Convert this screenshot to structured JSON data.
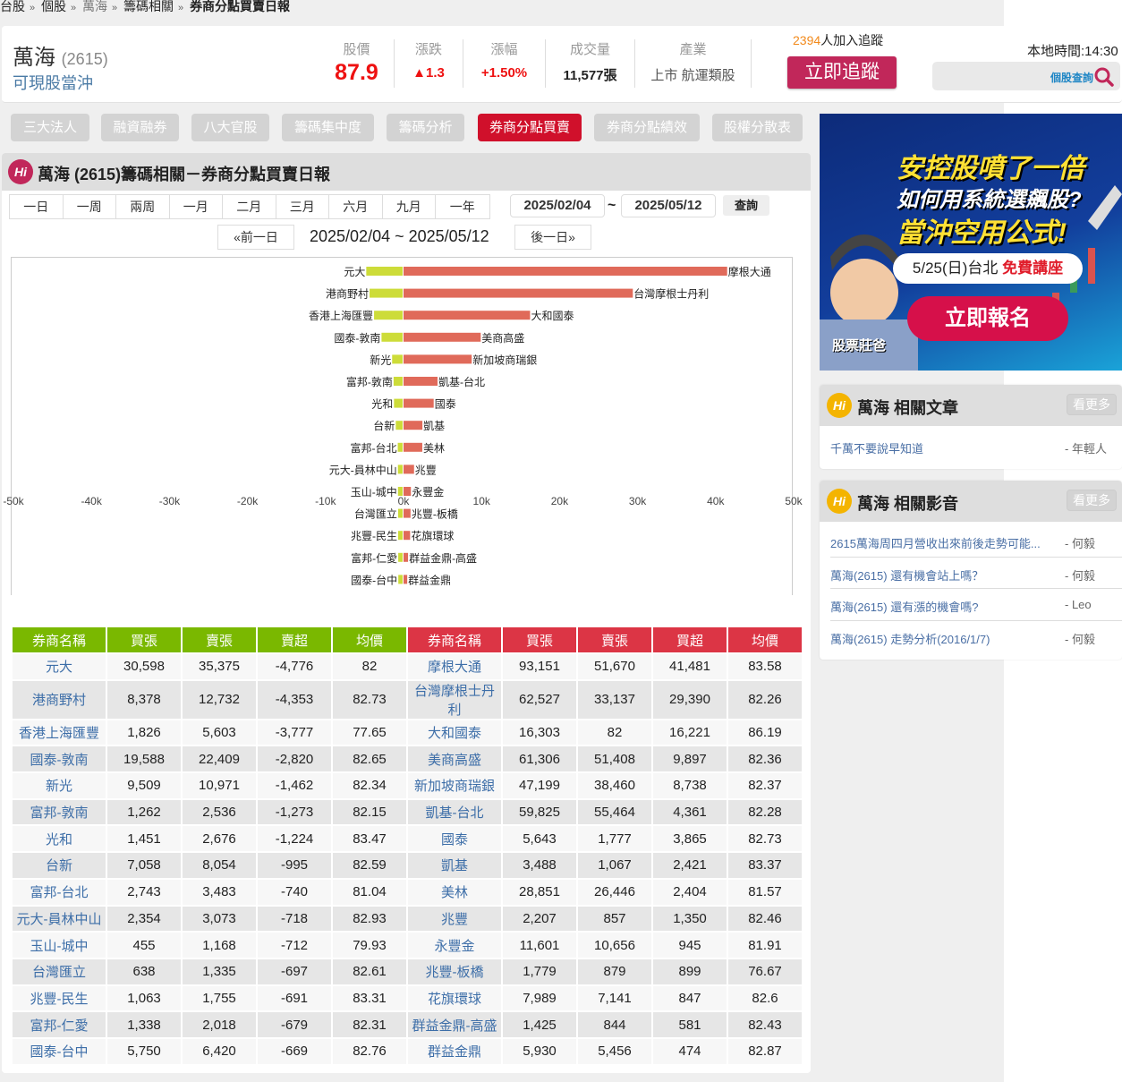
{
  "breadcrumb": [
    "台股",
    "個股",
    "萬海",
    "籌碼相關",
    "券商分點買賣日報"
  ],
  "stock": {
    "name": "萬海",
    "code": "(2615)",
    "tag": "可現股當沖"
  },
  "stats": [
    {
      "label": "股價",
      "value": "87.9",
      "color": "#ee1111"
    },
    {
      "label": "漲跌",
      "value": "▲1.3",
      "color": "#ee1111"
    },
    {
      "label": "漲幅",
      "value": "+1.50%",
      "color": "#ee1111"
    },
    {
      "label": "成交量",
      "value": "11,577張",
      "color": "#222222"
    },
    {
      "label": "產業",
      "value": "上市 航運類股",
      "color": "#555555"
    }
  ],
  "follow": {
    "count": "2394",
    "count_suffix": "人加入追蹤",
    "button": "立即追蹤"
  },
  "local_time": "本地時間:14:30",
  "search": {
    "label": "個股查詢"
  },
  "tabs": [
    {
      "label": "三大法人",
      "active": false
    },
    {
      "label": "融資融券",
      "active": false
    },
    {
      "label": "八大官股",
      "active": false
    },
    {
      "label": "籌碼集中度",
      "active": false
    },
    {
      "label": "籌碼分析",
      "active": false
    },
    {
      "label": "券商分點買賣",
      "active": true
    },
    {
      "label": "券商分點績效",
      "active": false
    },
    {
      "label": "股權分散表",
      "active": false
    }
  ],
  "panel": {
    "title": "萬海 (2615)籌碼相關－券商分點買賣日報",
    "periods": [
      "一日",
      "一周",
      "兩周",
      "一月",
      "二月",
      "三月",
      "六月",
      "九月",
      "一年"
    ],
    "start_date": "2025/02/04",
    "tilde": "~",
    "end_date": "2025/05/12",
    "query": "查詢",
    "prev": "«前一日",
    "next": "後一日»",
    "range": "2025/02/04 ~ 2025/05/12"
  },
  "colors": {
    "sell_bar": "#cddc39",
    "buy_bar": "#e06a5a",
    "sell_header": "#7ab800",
    "buy_header": "#dc3545",
    "accent": "#c1275a"
  },
  "chart_data": {
    "type": "bar",
    "orientation": "horizontal",
    "grid": false,
    "xlim": [
      -50000,
      50000
    ],
    "xticks": [
      "-50k",
      "-40k",
      "-30k",
      "-20k",
      "-10k",
      "0k",
      "10k",
      "20k",
      "30k",
      "40k",
      "50k"
    ],
    "sell_labels": [
      "元大",
      "港商野村",
      "香港上海匯豐",
      "國泰-敦南",
      "新光",
      "富邦-敦南",
      "光和",
      "台新",
      "富邦-台北",
      "元大-員林中山",
      "玉山-城中",
      "台灣匯立",
      "兆豐-民生",
      "富邦-仁愛",
      "國泰-台中"
    ],
    "sell_values": [
      -4776,
      -4353,
      -3777,
      -2820,
      -1462,
      -1273,
      -1224,
      -995,
      -740,
      -718,
      -712,
      -697,
      -691,
      -679,
      -669
    ],
    "buy_labels": [
      "摩根大通",
      "台灣摩根士丹利",
      "大和國泰",
      "美商高盛",
      "新加坡商瑞銀",
      "凱基-台北",
      "國泰",
      "凱基",
      "美林",
      "兆豐",
      "永豐金",
      "兆豐-板橋",
      "花旗環球",
      "群益金鼎-高盛",
      "群益金鼎"
    ],
    "buy_values": [
      41481,
      29390,
      16221,
      9897,
      8738,
      4361,
      3865,
      2421,
      2404,
      1350,
      945,
      899,
      847,
      581,
      474
    ]
  },
  "table": {
    "sell_headers": [
      "券商名稱",
      "買張",
      "賣張",
      "賣超",
      "均價"
    ],
    "buy_headers": [
      "券商名稱",
      "買張",
      "賣張",
      "買超",
      "均價"
    ],
    "rows": [
      [
        [
          "元大",
          "30,598",
          "35,375",
          "-4,776",
          "82"
        ],
        [
          "摩根大通",
          "93,151",
          "51,670",
          "41,481",
          "83.58"
        ]
      ],
      [
        [
          "港商野村",
          "8,378",
          "12,732",
          "-4,353",
          "82.73"
        ],
        [
          "台灣摩根士丹利",
          "62,527",
          "33,137",
          "29,390",
          "82.26"
        ]
      ],
      [
        [
          "香港上海匯豐",
          "1,826",
          "5,603",
          "-3,777",
          "77.65"
        ],
        [
          "大和國泰",
          "16,303",
          "82",
          "16,221",
          "86.19"
        ]
      ],
      [
        [
          "國泰-敦南",
          "19,588",
          "22,409",
          "-2,820",
          "82.65"
        ],
        [
          "美商高盛",
          "61,306",
          "51,408",
          "9,897",
          "82.36"
        ]
      ],
      [
        [
          "新光",
          "9,509",
          "10,971",
          "-1,462",
          "82.34"
        ],
        [
          "新加坡商瑞銀",
          "47,199",
          "38,460",
          "8,738",
          "82.37"
        ]
      ],
      [
        [
          "富邦-敦南",
          "1,262",
          "2,536",
          "-1,273",
          "82.15"
        ],
        [
          "凱基-台北",
          "59,825",
          "55,464",
          "4,361",
          "82.28"
        ]
      ],
      [
        [
          "光和",
          "1,451",
          "2,676",
          "-1,224",
          "83.47"
        ],
        [
          "國泰",
          "5,643",
          "1,777",
          "3,865",
          "82.73"
        ]
      ],
      [
        [
          "台新",
          "7,058",
          "8,054",
          "-995",
          "82.59"
        ],
        [
          "凱基",
          "3,488",
          "1,067",
          "2,421",
          "83.37"
        ]
      ],
      [
        [
          "富邦-台北",
          "2,743",
          "3,483",
          "-740",
          "81.04"
        ],
        [
          "美林",
          "28,851",
          "26,446",
          "2,404",
          "81.57"
        ]
      ],
      [
        [
          "元大-員林中山",
          "2,354",
          "3,073",
          "-718",
          "82.93"
        ],
        [
          "兆豐",
          "2,207",
          "857",
          "1,350",
          "82.46"
        ]
      ],
      [
        [
          "玉山-城中",
          "455",
          "1,168",
          "-712",
          "79.93"
        ],
        [
          "永豐金",
          "11,601",
          "10,656",
          "945",
          "81.91"
        ]
      ],
      [
        [
          "台灣匯立",
          "638",
          "1,335",
          "-697",
          "82.61"
        ],
        [
          "兆豐-板橋",
          "1,779",
          "879",
          "899",
          "76.67"
        ]
      ],
      [
        [
          "兆豐-民生",
          "1,063",
          "1,755",
          "-691",
          "83.31"
        ],
        [
          "花旗環球",
          "7,989",
          "7,141",
          "847",
          "82.6"
        ]
      ],
      [
        [
          "富邦-仁愛",
          "1,338",
          "2,018",
          "-679",
          "82.31"
        ],
        [
          "群益金鼎-高盛",
          "1,425",
          "844",
          "581",
          "82.43"
        ]
      ],
      [
        [
          "國泰-台中",
          "5,750",
          "6,420",
          "-669",
          "82.76"
        ],
        [
          "群益金鼎",
          "5,930",
          "5,456",
          "474",
          "82.87"
        ]
      ]
    ]
  },
  "ad": {
    "line1": "安控股噴了一倍",
    "line2": "如何用系統選飆股?",
    "line3": "當沖空用公式!",
    "date": "5/25(日)台北",
    "free": "免費講座",
    "cta": "立即報名",
    "brand": "股票莊爸"
  },
  "articles": {
    "title": "萬海 相關文章",
    "more": "看更多",
    "items": [
      {
        "title": "千萬不要說早知道",
        "author": "- 年輕人"
      }
    ]
  },
  "videos": {
    "title": "萬海 相關影音",
    "more": "看更多",
    "items": [
      {
        "title": "2615萬海周四月營收出來前後走勢可能...",
        "author": "- 何毅"
      },
      {
        "title": "萬海(2615) 還有機會站上嗎？",
        "author": "- 何毅"
      },
      {
        "title": "萬海(2615) 還有漲的機會嗎?",
        "author": "- Leo"
      },
      {
        "title": "萬海(2615) 走勢分析(2016/1/7)",
        "author": "- 何毅"
      }
    ]
  }
}
